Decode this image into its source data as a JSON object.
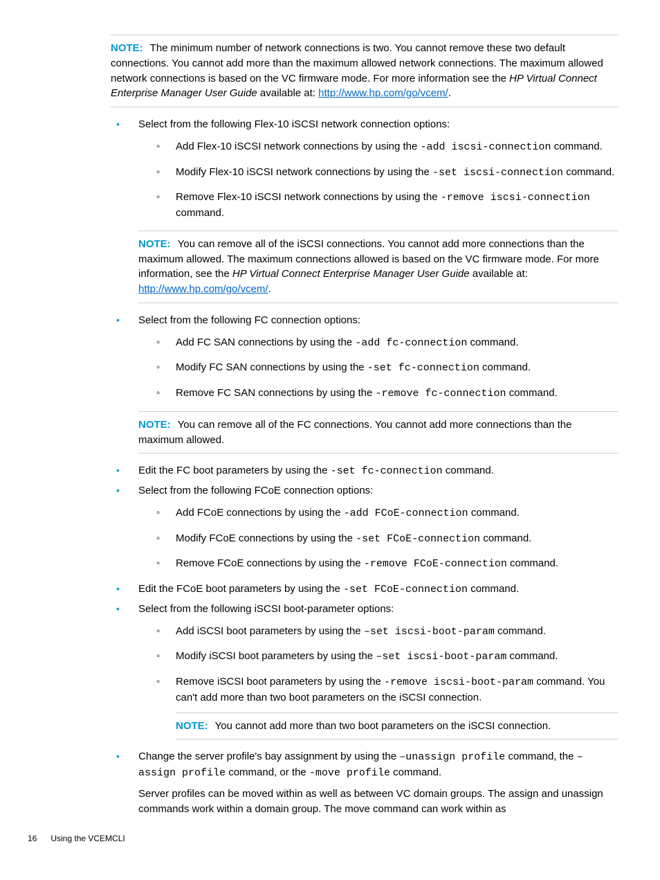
{
  "note1": {
    "label": "NOTE:",
    "body": "The minimum number of network connections is two. You cannot remove these two default connections. You cannot add more than the maximum allowed network connections. The maximum allowed network connections is based on the VC firmware mode. For more information see the ",
    "italic": "HP Virtual Connect Enterprise Manager User Guide",
    "after": " available at: ",
    "link": "http://www.hp.com/go/vcem/",
    "tail": "."
  },
  "iscsi": {
    "lead": "Select from the following Flex-10 iSCSI network connection options:",
    "items": [
      {
        "pre": "Add Flex-10 iSCSI network connections by using the ",
        "code": "-add iscsi-connection",
        "post": " command."
      },
      {
        "pre": "Modify Flex-10 iSCSI network connections by using the ",
        "code": "-set iscsi-connection",
        "post": " command."
      },
      {
        "pre": "Remove Flex-10 iSCSI network connections by using the ",
        "code": "-remove iscsi-connection",
        "post": " command."
      }
    ]
  },
  "note2": {
    "label": "NOTE:",
    "body": "You can remove all of the iSCSI connections. You cannot add more connections than the maximum allowed. The maximum connections allowed is based on the VC firmware mode. For more information, see the ",
    "italic": "HP Virtual Connect Enterprise Manager User Guide",
    "after": " available at: ",
    "link": "http://www.hp.com/go/vcem/",
    "tail": "."
  },
  "fc": {
    "lead": "Select from the following FC connection options:",
    "items": [
      {
        "pre": "Add FC SAN connections by using the ",
        "code": "-add fc-connection",
        "post": " command."
      },
      {
        "pre": "Modify FC SAN connections by using the ",
        "code": "-set fc-connection",
        "post": " command."
      },
      {
        "pre": "Remove FC SAN connections by using the ",
        "code": "-remove fc-connection",
        "post": " command."
      }
    ]
  },
  "note3": {
    "label": "NOTE:",
    "body": "You can remove all of the FC connections. You cannot add more connections than the maximum allowed."
  },
  "fcboot": {
    "pre": "Edit the FC boot parameters by using the ",
    "code": "-set fc-connection",
    "post": " command."
  },
  "fcoe": {
    "lead": "Select from the following FCoE connection options:",
    "items": [
      {
        "pre": "Add FCoE connections by using the  ",
        "code": "-add FCoE-connection",
        "post": " command."
      },
      {
        "pre": "Modify FCoE connections by using the ",
        "code": "-set FCoE-connection",
        "post": " command."
      },
      {
        "pre": "Remove FCoE connections by using the ",
        "code": "-remove FCoE-connection",
        "post": " command."
      }
    ]
  },
  "fcoeboot": {
    "pre": "Edit the FCoE boot parameters by using the ",
    "code": "-set FCoE-connection",
    "post": " command."
  },
  "iscsib": {
    "lead": "Select from the following iSCSI boot-parameter options:",
    "items": [
      {
        "pre": "Add iSCSI boot parameters by using the ",
        "code": "–set iscsi-boot-param",
        "post": " command."
      },
      {
        "pre": "Modify iSCSI boot parameters by using the ",
        "code": "–set iscsi-boot-param",
        "post": " command."
      },
      {
        "pre": "Remove iSCSI boot parameters by using the ",
        "code": "-remove iscsi-boot-param",
        "post": " command. You can't add more than two boot parameters on the iSCSI connection."
      }
    ]
  },
  "note4": {
    "label": "NOTE:",
    "body": "You cannot add more than two boot parameters on the iSCSI connection."
  },
  "assign": {
    "pre": "Change the server profile's bay assignment by using the ",
    "c1": "–unassign profile",
    "m1": " command, the ",
    "c2": "–assign profile",
    "m2": " command, or the ",
    "c3": "-move profile",
    "post": " command.",
    "para": "Server profiles can be moved within as well as between VC domain groups. The assign and unassign commands work within a domain group. The move command can work within as"
  },
  "footer": {
    "page": "16",
    "title": "Using the VCEMCLI"
  }
}
